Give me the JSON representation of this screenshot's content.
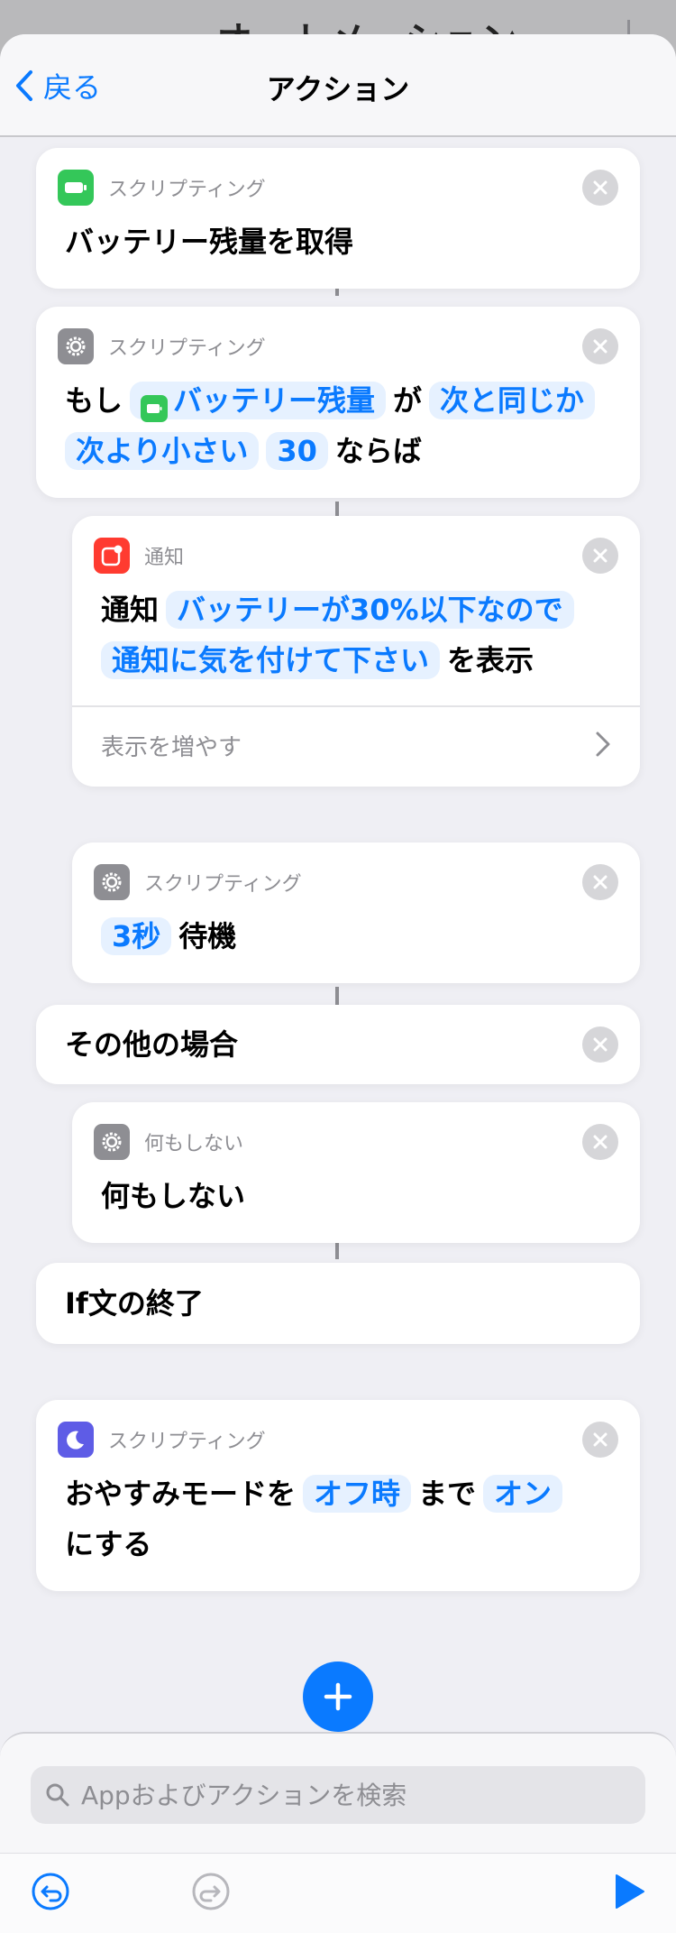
{
  "background": {
    "peek_title": "オートメーション"
  },
  "nav": {
    "back_label": "戻る",
    "title": "アクション"
  },
  "actions": {
    "get_battery": {
      "category": "スクリプティング",
      "text": "バッテリー残量を取得"
    },
    "if_block": {
      "category": "スクリプティング",
      "prefix": "もし",
      "var_token": "バッテリー残量",
      "particle": "が",
      "condition_1": "次と同じか",
      "condition_2": "次より小さい",
      "value": "30",
      "suffix": "ならば"
    },
    "notification": {
      "category": "通知",
      "prefix": "通知",
      "message_1": "バッテリーが30%以下なので",
      "message_2": "通知に気を付けて下さい",
      "suffix": "を表示",
      "show_more": "表示を増やす"
    },
    "wait": {
      "category": "スクリプティング",
      "duration": "3秒",
      "label": "待機"
    },
    "otherwise": {
      "label": "その他の場合"
    },
    "do_nothing": {
      "category": "何もしない",
      "text": "何もしない"
    },
    "end_if": {
      "label": "If文の終了"
    },
    "focus": {
      "category": "スクリプティング",
      "prefix": "おやすみモードを",
      "until_token": "オフ時",
      "mid": "まで",
      "state_token": "オン",
      "suffix": "にする"
    }
  },
  "search": {
    "placeholder": "Appおよびアクションを検索"
  },
  "colors": {
    "accent": "#0a7aff",
    "battery_green": "#34c759",
    "notification_red": "#ff3b30",
    "scripting_gray": "#8e8e93",
    "focus_indigo": "#5e5ce6"
  },
  "icons": {
    "back": "chevron-left-icon",
    "battery": "battery-icon",
    "gear": "gear-icon",
    "notification": "notification-icon",
    "moon": "moon-icon",
    "close": "close-icon",
    "chevron_right": "chevron-right-icon",
    "add": "plus-icon",
    "search": "search-icon",
    "undo": "undo-icon",
    "redo": "redo-icon",
    "play": "play-icon"
  }
}
